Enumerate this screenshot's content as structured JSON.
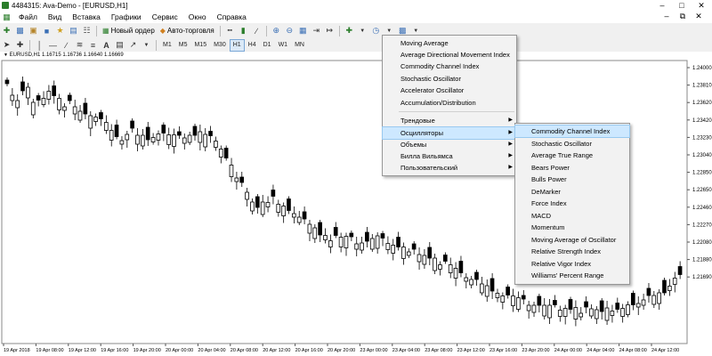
{
  "window": {
    "title": "4484315: Ava-Demo - [EURUSD,H1]"
  },
  "menubar": [
    "Файл",
    "Вид",
    "Вставка",
    "Графики",
    "Сервис",
    "Окно",
    "Справка"
  ],
  "toolbar": {
    "new_order": "Новый ордер",
    "autotrading": "Авто-торговля"
  },
  "timeframes": [
    "M1",
    "M5",
    "M15",
    "M30",
    "H1",
    "H4",
    "D1",
    "W1",
    "MN"
  ],
  "chart": {
    "symbol_info": "EURUSD,H1 1.16715 1.16736 1.16640 1.16669",
    "price_labels": [
      "1.24000",
      "1.23810",
      "1.23620",
      "1.23420",
      "1.23230",
      "1.23040",
      "1.22850",
      "1.22650",
      "1.22460",
      "1.22270",
      "1.22080",
      "1.21880",
      "1.21690"
    ],
    "time_labels": [
      "19 Apr 2018",
      "19 Apr 08:00",
      "19 Apr 12:00",
      "19 Apr 16:00",
      "19 Apr 20:00",
      "20 Apr 00:00",
      "20 Apr 04:00",
      "20 Apr 08:00",
      "20 Apr 12:00",
      "20 Apr 16:00",
      "20 Apr 20:00",
      "23 Apr 00:00",
      "23 Apr 04:00",
      "23 Apr 08:00",
      "23 Apr 12:00",
      "23 Apr 16:00",
      "23 Apr 20:00",
      "24 Apr 00:00",
      "24 Apr 04:00",
      "24 Apr 08:00",
      "24 Apr 12:00"
    ]
  },
  "indicators_menu": {
    "top_items": [
      "Moving Average",
      "Average Directional Movement Index",
      "Commodity Channel Index",
      "Stochastic Oscillator",
      "Accelerator Oscillator",
      "Accumulation/Distribution"
    ],
    "groups": [
      "Трендовые",
      "Осцилляторы",
      "Объемы",
      "Билла Вильямса",
      "Пользовательский"
    ],
    "highlighted_group": "Осцилляторы"
  },
  "oscillators_submenu": [
    "Commodity Channel Index",
    "Stochastic Oscillator",
    "Average True Range",
    "Bears Power",
    "Bulls Power",
    "DeMarker",
    "Force Index",
    "MACD",
    "Momentum",
    "Moving Average of Oscillator",
    "Relative Strength Index",
    "Relative Vigor Index",
    "Williams' Percent Range"
  ],
  "highlighted_submenu": "Commodity Channel Index",
  "colors": {
    "candle": "#000000",
    "chart_bg": "#ffffff",
    "grid": "#c8c8c8",
    "menu_highlight": "#cde8ff"
  }
}
